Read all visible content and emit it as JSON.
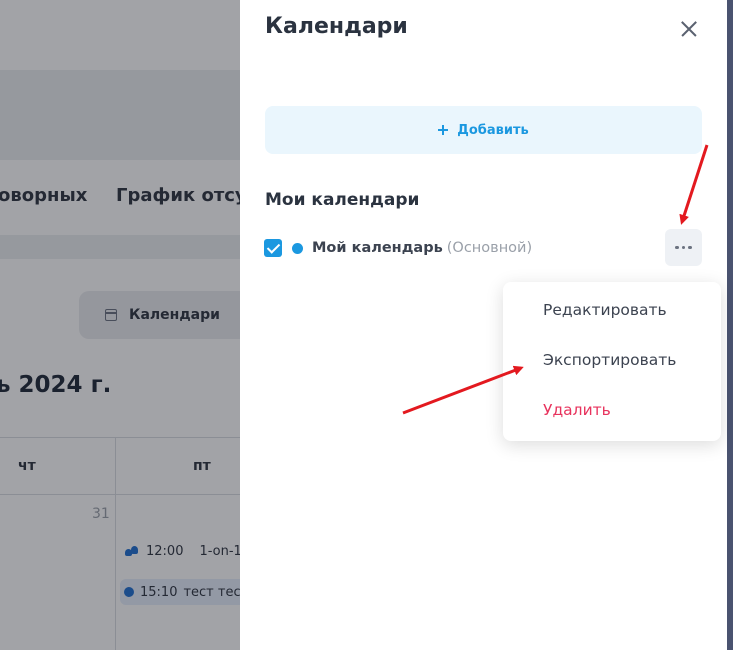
{
  "background_page": {
    "tabs": [
      "оворных",
      "График отсут"
    ],
    "calendars_button": "Календари",
    "month_title": "ь 2024 г.",
    "weekdays": [
      "чт",
      "пт"
    ],
    "date_number": "31",
    "events": [
      {
        "time": "12:00",
        "title": "1-on-1"
      },
      {
        "time": "15:10",
        "title": "тест тест"
      }
    ]
  },
  "drawer": {
    "title": "Календари",
    "add_button": "Добавить",
    "section_title": "Мои календари",
    "calendar_item": {
      "name": "Мой календарь",
      "subtitle": "(Основной)",
      "checked": true,
      "color": "#1b98e0"
    },
    "context_menu": {
      "items": [
        "Редактировать",
        "Экспортировать",
        "Удалить"
      ]
    }
  },
  "colors": {
    "accent": "#1b98e0",
    "danger": "#e8335d",
    "annotation_arrow": "#e3191f"
  }
}
